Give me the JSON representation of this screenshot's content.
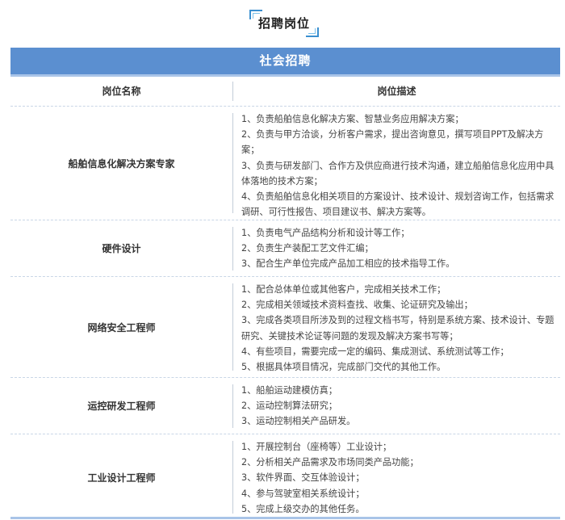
{
  "page_title": "招聘岗位",
  "section_title": "社会招聘",
  "table_headers": {
    "name": "岗位名称",
    "description": "岗位描述"
  },
  "rows": [
    {
      "name": "船舶信息化解决方案专家",
      "desc": [
        "1、负责船舶信息化解决方案、智慧业务应用解决方案；",
        "2、负责与甲方洽谈，分析客户需求，提出咨询意见，撰写项目PPT及解决方案；",
        "3、负责与研发部门、合作方及供应商进行技术沟通，建立船舶信息化应用中具体落地的技术方案；",
        "4、负责船舶信息化相关项目的方案设计、技术设计、规划咨询工作，包括需求调研、可行性报告、项目建议书、解决方案等。"
      ]
    },
    {
      "name": "硬件设计",
      "desc": [
        "1、负责电气产品结构分析和设计等工作；",
        "2、负责生产装配工艺文件汇编；",
        "3、配合生产单位完成产品加工相应的技术指导工作。"
      ]
    },
    {
      "name": "网络安全工程师",
      "desc": [
        "1、配合总体单位或其他客户，完成相关技术工作；",
        "2、完成相关领域技术资料查找、收集、论证研究及输出；",
        "3、完成各类项目所涉及到的过程文档书写，特别是系统方案、技术设计、专题研究、关键技术论证等问题的发现及解决方案书写等；",
        "4、有些项目，需要完成一定的编码、集成测试、系统测试等工作；",
        "5、根据具体项目情况，完成部门交代的其他工作。"
      ]
    },
    {
      "name": "运控研发工程师",
      "desc": [
        "1、船舶运动建模仿真；",
        "2、运动控制算法研究；",
        "3、运动控制相关产品研发。"
      ]
    },
    {
      "name": "工业设计工程师",
      "desc": [
        "1、开展控制台（座椅等）工业设计；",
        "2、分析相关产品需求及市场同类产品功能；",
        "3、软件界面、交互体验设计；",
        "4、参与驾驶室相关系统设计；",
        "5、完成上级交办的其他任务。"
      ]
    }
  ],
  "colors": {
    "banner": "#5b8fd0",
    "accent": "#3a8fd0"
  }
}
